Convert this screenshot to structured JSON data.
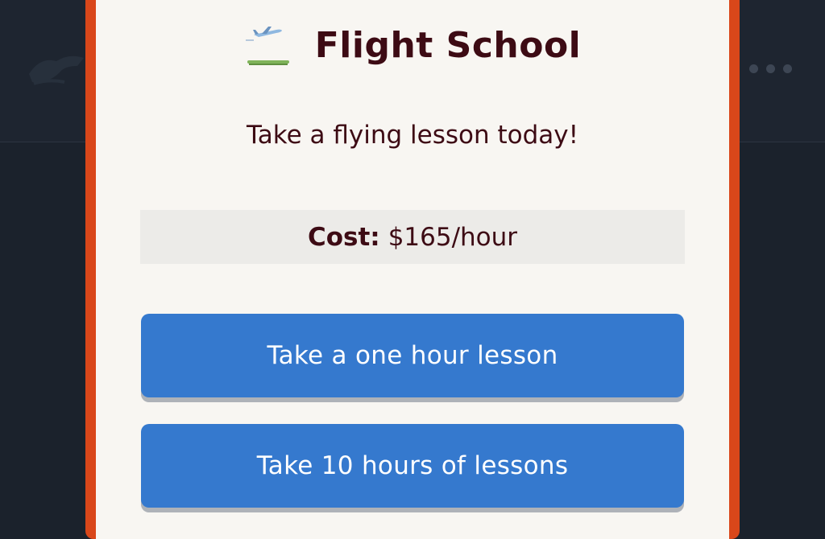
{
  "modal": {
    "title": "Flight School",
    "title_icon": "airplane-takeoff-icon",
    "subtitle": "Take a flying lesson today!",
    "cost": {
      "label": "Cost:",
      "value": "$165/hour"
    },
    "buttons": [
      {
        "label": "Take a one hour lesson"
      },
      {
        "label": "Take 10 hours of lessons"
      }
    ]
  },
  "background": {
    "icons": [
      "shadowed-activity-icon",
      "more-icon"
    ]
  },
  "colors": {
    "modal_border": "#d9471a",
    "modal_bg": "#f8f6f2",
    "text_primary": "#3d0b14",
    "button": "#3579ce",
    "backdrop": "#1b222c"
  }
}
